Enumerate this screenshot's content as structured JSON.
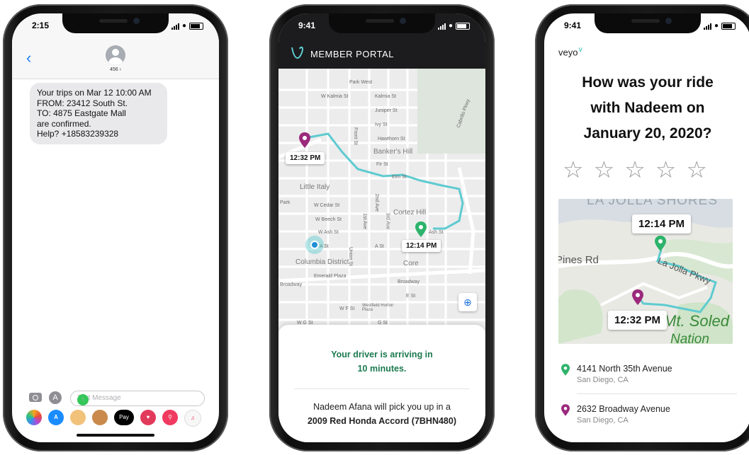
{
  "phone1": {
    "status_time": "2:15",
    "contact": "456",
    "message_lines": [
      "Your trips on Mar 12 10:00 AM",
      "FROM: 23412 South St.",
      "TO: 4875 Eastgate Mall",
      "are confirmed.",
      "Help? +18583239328"
    ],
    "input_placeholder": "Text Message",
    "tray": [
      "photos",
      "app-store",
      "memoji",
      "monkey",
      "Pay",
      "heart",
      "search",
      "music"
    ],
    "pay_label": "Pay"
  },
  "phone2": {
    "status_time": "9:41",
    "portal_title": "MEMBER PORTAL",
    "map_labels": {
      "park_west": "Park West",
      "w_kalmia": "W Kalmia St",
      "kalmia": "Kalmia St",
      "juniper": "Juniper St",
      "ivy": "Ivy St",
      "hawthorn": "Hawthorn St",
      "bankers_hill": "Banker's Hill",
      "fir": "Fir St",
      "elm": "Elm St",
      "little_italy": "Little Italy",
      "w_cedar": "W Cedar St",
      "cortez_hill": "Cortez Hill",
      "w_beech": "W Beech St",
      "w_ash": "W Ash St",
      "a_st": "A St",
      "columbia": "Columbia District",
      "core": "Core",
      "emerald": "Emerald Plaza",
      "broadway": "Broadway",
      "e_st": "E St",
      "w_f": "W F St",
      "westfield": "Westfield Horton Plaza",
      "g_st": "G St",
      "wg_st": "W G St",
      "cabrillo": "Cabrillo Pkwy",
      "park": "Park",
      "ash_st": "Ash St",
      "union": "Union St",
      "front": "Front St",
      "first": "1st Ave",
      "second": "2nd Ave",
      "third": "3rd Ave"
    },
    "pickup_time": "12:32 PM",
    "dropoff_time": "12:14 PM",
    "arriving_line1": "Your driver is arriving in",
    "arriving_line2": "10 minutes.",
    "pick_line1": "Nadeem Afana will pick you up in a",
    "pick_line2": "2009 Red Honda Accord (7BHN480)",
    "colors": {
      "route": "#5ecbd0",
      "pickup_pin": "#9b2a7c",
      "dropoff_pin": "#2db36b",
      "arriving": "#1b7a4f"
    }
  },
  "phone3": {
    "status_time": "9:41",
    "brand": "veyo",
    "question_lines": [
      "How was your ride",
      "with Nadeem on",
      "January 20, 2020?"
    ],
    "star_rating": 0,
    "stars_total": 5,
    "map_labels": {
      "shores": "LA JOLLA SHORES",
      "pines": "Pines Rd",
      "parkway": "La Jolla Pkwy",
      "soled": "Mt. Soled",
      "nation": "Nation"
    },
    "time_top": "12:14 PM",
    "time_bottom": "12:32 PM",
    "addresses": [
      {
        "street": "4141 North 35th Avenue",
        "city": "San Diego, CA",
        "pin": "green-pin-icon"
      },
      {
        "street": "2632 Broadway Avenue",
        "city": "San Diego, CA",
        "pin": "purple-pin-icon"
      }
    ]
  }
}
